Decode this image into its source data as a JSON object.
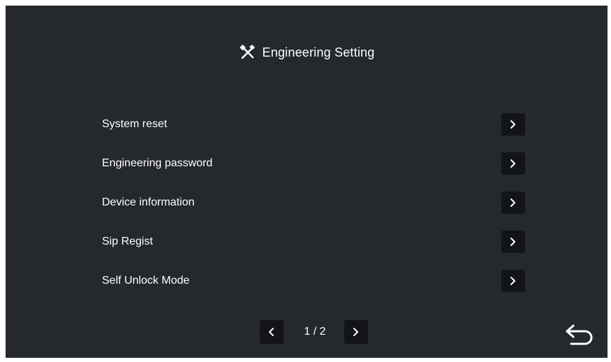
{
  "header": {
    "title": "Engineering Setting",
    "icon": "tools-icon"
  },
  "menu": {
    "items": [
      {
        "label": "System reset",
        "icon": "chevron-right-icon"
      },
      {
        "label": "Engineering password",
        "icon": "chevron-right-icon"
      },
      {
        "label": "Device information",
        "icon": "chevron-right-icon"
      },
      {
        "label": "Sip Regist",
        "icon": "chevron-right-icon"
      },
      {
        "label": "Self Unlock Mode",
        "icon": "chevron-right-icon"
      }
    ]
  },
  "pager": {
    "indicator": "1 / 2",
    "prev_icon": "chevron-left-icon",
    "next_icon": "chevron-right-icon"
  },
  "footer": {
    "back_icon": "back-arrow-icon"
  },
  "colors": {
    "background": "#25282d",
    "button": "#121417",
    "text": "#ffffff"
  }
}
